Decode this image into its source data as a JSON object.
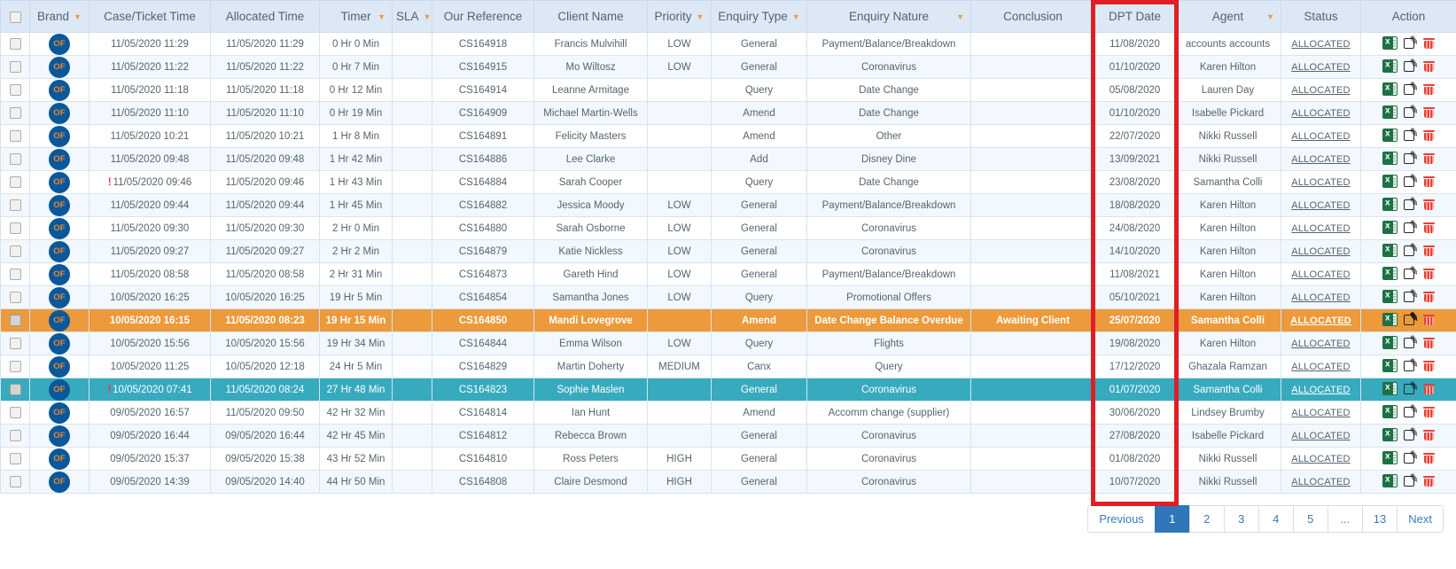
{
  "brand_badge": "OF",
  "alert_indicator": "!",
  "annotation": {
    "label": "dpt-date-column-highlight",
    "color": "#E01E25"
  },
  "icons": {
    "sort": "sort-arrow-icon",
    "excel": "excel-export-icon",
    "edit": "edit-icon",
    "delete": "delete-icon",
    "checkbox": "row-checkbox"
  },
  "table": {
    "columns": [
      {
        "key": "select",
        "label": "",
        "sortable": false,
        "arrow_edge": false
      },
      {
        "key": "brand",
        "label": "Brand",
        "sortable": true,
        "arrow_edge": false
      },
      {
        "key": "case_time",
        "label": "Case/Ticket Time",
        "sortable": false,
        "arrow_edge": false
      },
      {
        "key": "allocated_time",
        "label": "Allocated Time",
        "sortable": false,
        "arrow_edge": false
      },
      {
        "key": "timer",
        "label": "Timer",
        "sortable": true,
        "arrow_edge": true
      },
      {
        "key": "sla",
        "label": "SLA",
        "sortable": true,
        "arrow_edge": false
      },
      {
        "key": "reference",
        "label": "Our Reference",
        "sortable": false,
        "arrow_edge": false
      },
      {
        "key": "client",
        "label": "Client Name",
        "sortable": false,
        "arrow_edge": false
      },
      {
        "key": "priority",
        "label": "Priority",
        "sortable": true,
        "arrow_edge": false
      },
      {
        "key": "enquiry_type",
        "label": "Enquiry Type",
        "sortable": true,
        "arrow_edge": false
      },
      {
        "key": "enquiry_nature",
        "label": "Enquiry Nature",
        "sortable": true,
        "arrow_edge": true
      },
      {
        "key": "conclusion",
        "label": "Conclusion",
        "sortable": false,
        "arrow_edge": false
      },
      {
        "key": "dpt_date",
        "label": "DPT Date",
        "sortable": false,
        "arrow_edge": false
      },
      {
        "key": "agent",
        "label": "Agent",
        "sortable": true,
        "arrow_edge": true
      },
      {
        "key": "status",
        "label": "Status",
        "sortable": false,
        "arrow_edge": false
      },
      {
        "key": "action",
        "label": "Action",
        "sortable": false,
        "arrow_edge": false
      }
    ],
    "rows": [
      {
        "alert": false,
        "highlight": "",
        "case_time": "11/05/2020 11:29",
        "allocated_time": "11/05/2020 11:29",
        "timer": "0 Hr 0 Min",
        "sla": "",
        "reference": "CS164918",
        "client": "Francis Mulvihill",
        "priority": "LOW",
        "enquiry_type": "General",
        "enquiry_nature": "Payment/Balance/Breakdown",
        "conclusion": "",
        "dpt_date": "11/08/2020",
        "agent": "accounts accounts",
        "status": "ALLOCATED"
      },
      {
        "alert": false,
        "highlight": "",
        "case_time": "11/05/2020 11:22",
        "allocated_time": "11/05/2020 11:22",
        "timer": "0 Hr 7 Min",
        "sla": "",
        "reference": "CS164915",
        "client": "Mo Wiltosz",
        "priority": "LOW",
        "enquiry_type": "General",
        "enquiry_nature": "Coronavirus",
        "conclusion": "",
        "dpt_date": "01/10/2020",
        "agent": "Karen Hilton",
        "status": "ALLOCATED"
      },
      {
        "alert": false,
        "highlight": "",
        "case_time": "11/05/2020 11:18",
        "allocated_time": "11/05/2020 11:18",
        "timer": "0 Hr 12 Min",
        "sla": "",
        "reference": "CS164914",
        "client": "Leanne Armitage",
        "priority": "",
        "enquiry_type": "Query",
        "enquiry_nature": "Date Change",
        "conclusion": "",
        "dpt_date": "05/08/2020",
        "agent": "Lauren Day",
        "status": "ALLOCATED"
      },
      {
        "alert": false,
        "highlight": "",
        "case_time": "11/05/2020 11:10",
        "allocated_time": "11/05/2020 11:10",
        "timer": "0 Hr 19 Min",
        "sla": "",
        "reference": "CS164909",
        "client": "Michael Martin-Wells",
        "priority": "",
        "enquiry_type": "Amend",
        "enquiry_nature": "Date Change",
        "conclusion": "",
        "dpt_date": "01/10/2020",
        "agent": "Isabelle Pickard",
        "status": "ALLOCATED"
      },
      {
        "alert": false,
        "highlight": "",
        "case_time": "11/05/2020 10:21",
        "allocated_time": "11/05/2020 10:21",
        "timer": "1 Hr 8 Min",
        "sla": "",
        "reference": "CS164891",
        "client": "Felicity Masters",
        "priority": "",
        "enquiry_type": "Amend",
        "enquiry_nature": "Other",
        "conclusion": "",
        "dpt_date": "22/07/2020",
        "agent": "Nikki Russell",
        "status": "ALLOCATED"
      },
      {
        "alert": false,
        "highlight": "",
        "case_time": "11/05/2020 09:48",
        "allocated_time": "11/05/2020 09:48",
        "timer": "1 Hr 42 Min",
        "sla": "",
        "reference": "CS164886",
        "client": "Lee Clarke",
        "priority": "",
        "enquiry_type": "Add",
        "enquiry_nature": "Disney Dine",
        "conclusion": "",
        "dpt_date": "13/09/2021",
        "agent": "Nikki Russell",
        "status": "ALLOCATED"
      },
      {
        "alert": true,
        "highlight": "",
        "case_time": "11/05/2020 09:46",
        "allocated_time": "11/05/2020 09:46",
        "timer": "1 Hr 43 Min",
        "sla": "",
        "reference": "CS164884",
        "client": "Sarah Cooper",
        "priority": "",
        "enquiry_type": "Query",
        "enquiry_nature": "Date Change",
        "conclusion": "",
        "dpt_date": "23/08/2020",
        "agent": "Samantha Colli",
        "status": "ALLOCATED"
      },
      {
        "alert": false,
        "highlight": "",
        "case_time": "11/05/2020 09:44",
        "allocated_time": "11/05/2020 09:44",
        "timer": "1 Hr 45 Min",
        "sla": "",
        "reference": "CS164882",
        "client": "Jessica Moody",
        "priority": "LOW",
        "enquiry_type": "General",
        "enquiry_nature": "Payment/Balance/Breakdown",
        "conclusion": "",
        "dpt_date": "18/08/2020",
        "agent": "Karen Hilton",
        "status": "ALLOCATED"
      },
      {
        "alert": false,
        "highlight": "",
        "case_time": "11/05/2020 09:30",
        "allocated_time": "11/05/2020 09:30",
        "timer": "2 Hr 0 Min",
        "sla": "",
        "reference": "CS164880",
        "client": "Sarah Osborne",
        "priority": "LOW",
        "enquiry_type": "General",
        "enquiry_nature": "Coronavirus",
        "conclusion": "",
        "dpt_date": "24/08/2020",
        "agent": "Karen Hilton",
        "status": "ALLOCATED"
      },
      {
        "alert": false,
        "highlight": "",
        "case_time": "11/05/2020 09:27",
        "allocated_time": "11/05/2020 09:27",
        "timer": "2 Hr 2 Min",
        "sla": "",
        "reference": "CS164879",
        "client": "Katie Nickless",
        "priority": "LOW",
        "enquiry_type": "General",
        "enquiry_nature": "Coronavirus",
        "conclusion": "",
        "dpt_date": "14/10/2020",
        "agent": "Karen Hilton",
        "status": "ALLOCATED"
      },
      {
        "alert": false,
        "highlight": "",
        "case_time": "11/05/2020 08:58",
        "allocated_time": "11/05/2020 08:58",
        "timer": "2 Hr 31 Min",
        "sla": "",
        "reference": "CS164873",
        "client": "Gareth Hind",
        "priority": "LOW",
        "enquiry_type": "General",
        "enquiry_nature": "Payment/Balance/Breakdown",
        "conclusion": "",
        "dpt_date": "11/08/2021",
        "agent": "Karen Hilton",
        "status": "ALLOCATED"
      },
      {
        "alert": false,
        "highlight": "",
        "case_time": "10/05/2020 16:25",
        "allocated_time": "10/05/2020 16:25",
        "timer": "19 Hr 5 Min",
        "sla": "",
        "reference": "CS164854",
        "client": "Samantha Jones",
        "priority": "LOW",
        "enquiry_type": "Query",
        "enquiry_nature": "Promotional Offers",
        "conclusion": "",
        "dpt_date": "05/10/2021",
        "agent": "Karen Hilton",
        "status": "ALLOCATED"
      },
      {
        "alert": false,
        "highlight": "orange",
        "case_time": "10/05/2020 16:15",
        "allocated_time": "11/05/2020 08:23",
        "timer": "19 Hr 15 Min",
        "sla": "",
        "reference": "CS164850",
        "client": "Mandi Lovegrove",
        "priority": "",
        "enquiry_type": "Amend",
        "enquiry_nature": "Date Change Balance Overdue",
        "conclusion": "Awaiting Client",
        "dpt_date": "25/07/2020",
        "agent": "Samantha Colli",
        "status": "ALLOCATED"
      },
      {
        "alert": false,
        "highlight": "",
        "case_time": "10/05/2020 15:56",
        "allocated_time": "10/05/2020 15:56",
        "timer": "19 Hr 34 Min",
        "sla": "",
        "reference": "CS164844",
        "client": "Emma Wilson",
        "priority": "LOW",
        "enquiry_type": "Query",
        "enquiry_nature": "Flights",
        "conclusion": "",
        "dpt_date": "19/08/2020",
        "agent": "Karen Hilton",
        "status": "ALLOCATED"
      },
      {
        "alert": false,
        "highlight": "",
        "case_time": "10/05/2020 11:25",
        "allocated_time": "10/05/2020 12:18",
        "timer": "24 Hr 5 Min",
        "sla": "",
        "reference": "CS164829",
        "client": "Martin Doherty",
        "priority": "MEDIUM",
        "enquiry_type": "Canx",
        "enquiry_nature": "Query",
        "conclusion": "",
        "dpt_date": "17/12/2020",
        "agent": "Ghazala Ramzan",
        "status": "ALLOCATED"
      },
      {
        "alert": true,
        "highlight": "teal",
        "case_time": "10/05/2020 07:41",
        "allocated_time": "11/05/2020 08:24",
        "timer": "27 Hr 48 Min",
        "sla": "",
        "reference": "CS164823",
        "client": "Sophie Maslen",
        "priority": "",
        "enquiry_type": "General",
        "enquiry_nature": "Coronavirus",
        "conclusion": "",
        "dpt_date": "01/07/2020",
        "agent": "Samantha Colli",
        "status": "ALLOCATED"
      },
      {
        "alert": false,
        "highlight": "",
        "case_time": "09/05/2020 16:57",
        "allocated_time": "11/05/2020 09:50",
        "timer": "42 Hr 32 Min",
        "sla": "",
        "reference": "CS164814",
        "client": "Ian Hunt",
        "priority": "",
        "enquiry_type": "Amend",
        "enquiry_nature": "Accomm change (supplier)",
        "conclusion": "",
        "dpt_date": "30/06/2020",
        "agent": "Lindsey Brumby",
        "status": "ALLOCATED"
      },
      {
        "alert": false,
        "highlight": "",
        "case_time": "09/05/2020 16:44",
        "allocated_time": "09/05/2020 16:44",
        "timer": "42 Hr 45 Min",
        "sla": "",
        "reference": "CS164812",
        "client": "Rebecca Brown",
        "priority": "",
        "enquiry_type": "General",
        "enquiry_nature": "Coronavirus",
        "conclusion": "",
        "dpt_date": "27/08/2020",
        "agent": "Isabelle Pickard",
        "status": "ALLOCATED"
      },
      {
        "alert": false,
        "highlight": "",
        "case_time": "09/05/2020 15:37",
        "allocated_time": "09/05/2020 15:38",
        "timer": "43 Hr 52 Min",
        "sla": "",
        "reference": "CS164810",
        "client": "Ross Peters",
        "priority": "HIGH",
        "enquiry_type": "General",
        "enquiry_nature": "Coronavirus",
        "conclusion": "",
        "dpt_date": "01/08/2020",
        "agent": "Nikki Russell",
        "status": "ALLOCATED"
      },
      {
        "alert": false,
        "highlight": "",
        "case_time": "09/05/2020 14:39",
        "allocated_time": "09/05/2020 14:40",
        "timer": "44 Hr 50 Min",
        "sla": "",
        "reference": "CS164808",
        "client": "Claire Desmond",
        "priority": "HIGH",
        "enquiry_type": "General",
        "enquiry_nature": "Coronavirus",
        "conclusion": "",
        "dpt_date": "10/07/2020",
        "agent": "Nikki Russell",
        "status": "ALLOCATED"
      }
    ]
  },
  "pagination": {
    "previous": "Previous",
    "next": "Next",
    "pages": [
      "1",
      "2",
      "3",
      "4",
      "5",
      "...",
      "13"
    ],
    "active_page": "1"
  }
}
